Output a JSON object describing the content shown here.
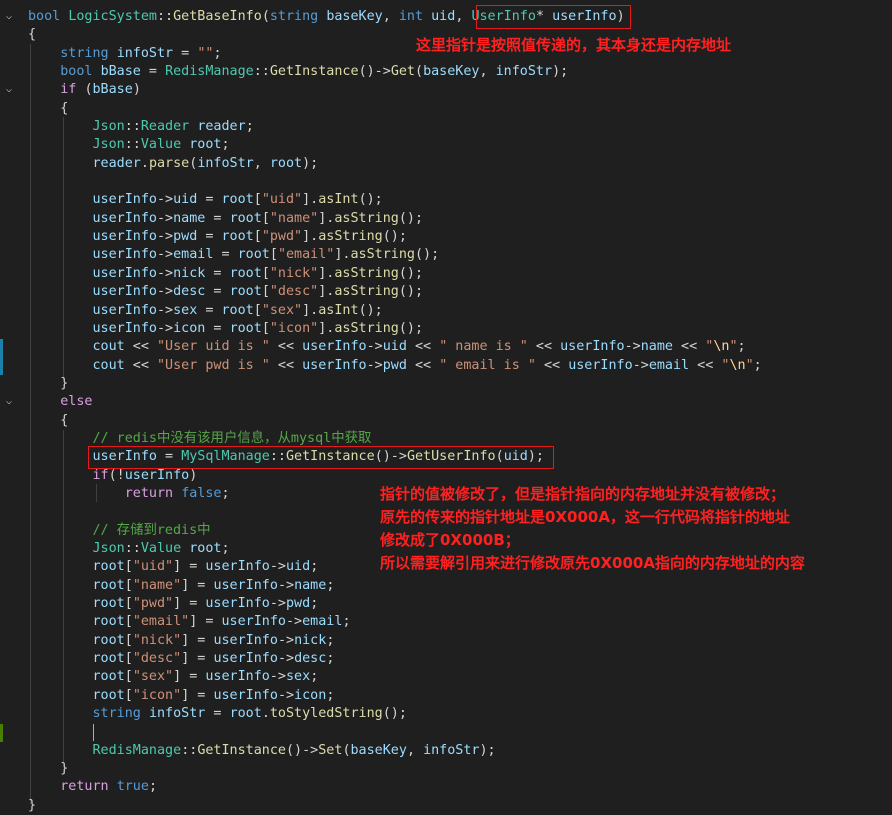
{
  "code": [
    [
      [
        "kw",
        "bool "
      ],
      [
        "ty",
        "LogicSystem"
      ],
      [
        "op",
        "::"
      ],
      [
        "fn",
        "GetBaseInfo"
      ],
      [
        "op",
        "("
      ],
      [
        "kw",
        "string "
      ],
      [
        "vr",
        "baseKey"
      ],
      [
        "op",
        ", "
      ],
      [
        "kw",
        "int "
      ],
      [
        "vr",
        "uid"
      ],
      [
        "op",
        ", "
      ],
      [
        "ty",
        "UserInfo"
      ],
      [
        "op",
        "* "
      ],
      [
        "vr",
        "userInfo"
      ],
      [
        "op",
        ")"
      ]
    ],
    [
      [
        "op",
        "{"
      ]
    ],
    [
      [
        "op",
        "    "
      ],
      [
        "kw",
        "string "
      ],
      [
        "vr",
        "infoStr"
      ],
      [
        "op",
        " = "
      ],
      [
        "st",
        "\"\""
      ],
      [
        "op",
        ";"
      ]
    ],
    [
      [
        "op",
        "    "
      ],
      [
        "kw",
        "bool "
      ],
      [
        "vr",
        "bBase"
      ],
      [
        "op",
        " = "
      ],
      [
        "ty",
        "RedisManage"
      ],
      [
        "op",
        "::"
      ],
      [
        "fn",
        "GetInstance"
      ],
      [
        "op",
        "()->"
      ],
      [
        "fn",
        "Get"
      ],
      [
        "op",
        "("
      ],
      [
        "vr",
        "baseKey"
      ],
      [
        "op",
        ", "
      ],
      [
        "vr",
        "infoStr"
      ],
      [
        "op",
        ");"
      ]
    ],
    [
      [
        "op",
        "    "
      ],
      [
        "fl",
        "if "
      ],
      [
        "op",
        "("
      ],
      [
        "vr",
        "bBase"
      ],
      [
        "op",
        ")"
      ]
    ],
    [
      [
        "op",
        "    {"
      ]
    ],
    [
      [
        "op",
        "        "
      ],
      [
        "ty",
        "Json"
      ],
      [
        "op",
        "::"
      ],
      [
        "ty",
        "Reader "
      ],
      [
        "vr",
        "reader"
      ],
      [
        "op",
        ";"
      ]
    ],
    [
      [
        "op",
        "        "
      ],
      [
        "ty",
        "Json"
      ],
      [
        "op",
        "::"
      ],
      [
        "ty",
        "Value "
      ],
      [
        "vr",
        "root"
      ],
      [
        "op",
        ";"
      ]
    ],
    [
      [
        "op",
        "        "
      ],
      [
        "vr",
        "reader"
      ],
      [
        "op",
        "."
      ],
      [
        "fn",
        "parse"
      ],
      [
        "op",
        "("
      ],
      [
        "vr",
        "infoStr"
      ],
      [
        "op",
        ", "
      ],
      [
        "vr",
        "root"
      ],
      [
        "op",
        ");"
      ]
    ],
    [],
    [
      [
        "op",
        "        "
      ],
      [
        "vr",
        "userInfo"
      ],
      [
        "op",
        "->"
      ],
      [
        "vr",
        "uid"
      ],
      [
        "op",
        " = "
      ],
      [
        "vr",
        "root"
      ],
      [
        "op",
        "["
      ],
      [
        "st",
        "\"uid\""
      ],
      [
        "op",
        "]."
      ],
      [
        "fn",
        "asInt"
      ],
      [
        "op",
        "();"
      ]
    ],
    [
      [
        "op",
        "        "
      ],
      [
        "vr",
        "userInfo"
      ],
      [
        "op",
        "->"
      ],
      [
        "vr",
        "name"
      ],
      [
        "op",
        " = "
      ],
      [
        "vr",
        "root"
      ],
      [
        "op",
        "["
      ],
      [
        "st",
        "\"name\""
      ],
      [
        "op",
        "]."
      ],
      [
        "fn",
        "asString"
      ],
      [
        "op",
        "();"
      ]
    ],
    [
      [
        "op",
        "        "
      ],
      [
        "vr",
        "userInfo"
      ],
      [
        "op",
        "->"
      ],
      [
        "vr",
        "pwd"
      ],
      [
        "op",
        " = "
      ],
      [
        "vr",
        "root"
      ],
      [
        "op",
        "["
      ],
      [
        "st",
        "\"pwd\""
      ],
      [
        "op",
        "]."
      ],
      [
        "fn",
        "asString"
      ],
      [
        "op",
        "();"
      ]
    ],
    [
      [
        "op",
        "        "
      ],
      [
        "vr",
        "userInfo"
      ],
      [
        "op",
        "->"
      ],
      [
        "vr",
        "email"
      ],
      [
        "op",
        " = "
      ],
      [
        "vr",
        "root"
      ],
      [
        "op",
        "["
      ],
      [
        "st",
        "\"email\""
      ],
      [
        "op",
        "]."
      ],
      [
        "fn",
        "asString"
      ],
      [
        "op",
        "();"
      ]
    ],
    [
      [
        "op",
        "        "
      ],
      [
        "vr",
        "userInfo"
      ],
      [
        "op",
        "->"
      ],
      [
        "vr",
        "nick"
      ],
      [
        "op",
        " = "
      ],
      [
        "vr",
        "root"
      ],
      [
        "op",
        "["
      ],
      [
        "st",
        "\"nick\""
      ],
      [
        "op",
        "]."
      ],
      [
        "fn",
        "asString"
      ],
      [
        "op",
        "();"
      ]
    ],
    [
      [
        "op",
        "        "
      ],
      [
        "vr",
        "userInfo"
      ],
      [
        "op",
        "->"
      ],
      [
        "vr",
        "desc"
      ],
      [
        "op",
        " = "
      ],
      [
        "vr",
        "root"
      ],
      [
        "op",
        "["
      ],
      [
        "st",
        "\"desc\""
      ],
      [
        "op",
        "]."
      ],
      [
        "fn",
        "asString"
      ],
      [
        "op",
        "();"
      ]
    ],
    [
      [
        "op",
        "        "
      ],
      [
        "vr",
        "userInfo"
      ],
      [
        "op",
        "->"
      ],
      [
        "vr",
        "sex"
      ],
      [
        "op",
        " = "
      ],
      [
        "vr",
        "root"
      ],
      [
        "op",
        "["
      ],
      [
        "st",
        "\"sex\""
      ],
      [
        "op",
        "]."
      ],
      [
        "fn",
        "asInt"
      ],
      [
        "op",
        "();"
      ]
    ],
    [
      [
        "op",
        "        "
      ],
      [
        "vr",
        "userInfo"
      ],
      [
        "op",
        "->"
      ],
      [
        "vr",
        "icon"
      ],
      [
        "op",
        " = "
      ],
      [
        "vr",
        "root"
      ],
      [
        "op",
        "["
      ],
      [
        "st",
        "\"icon\""
      ],
      [
        "op",
        "]."
      ],
      [
        "fn",
        "asString"
      ],
      [
        "op",
        "();"
      ]
    ],
    [
      [
        "op",
        "        "
      ],
      [
        "vr",
        "cout"
      ],
      [
        "op",
        " << "
      ],
      [
        "st",
        "\"User uid is \""
      ],
      [
        "op",
        " << "
      ],
      [
        "vr",
        "userInfo"
      ],
      [
        "op",
        "->"
      ],
      [
        "vr",
        "uid"
      ],
      [
        "op",
        " << "
      ],
      [
        "st",
        "\" name is \""
      ],
      [
        "op",
        " << "
      ],
      [
        "vr",
        "userInfo"
      ],
      [
        "op",
        "->"
      ],
      [
        "vr",
        "name"
      ],
      [
        "op",
        " << "
      ],
      [
        "st",
        "\""
      ],
      [
        "es",
        "\\n"
      ],
      [
        "st",
        "\""
      ],
      [
        "op",
        ";"
      ]
    ],
    [
      [
        "op",
        "        "
      ],
      [
        "vr",
        "cout"
      ],
      [
        "op",
        " << "
      ],
      [
        "st",
        "\"User pwd is \""
      ],
      [
        "op",
        " << "
      ],
      [
        "vr",
        "userInfo"
      ],
      [
        "op",
        "->"
      ],
      [
        "vr",
        "pwd"
      ],
      [
        "op",
        " << "
      ],
      [
        "st",
        "\" email is \""
      ],
      [
        "op",
        " << "
      ],
      [
        "vr",
        "userInfo"
      ],
      [
        "op",
        "->"
      ],
      [
        "vr",
        "email"
      ],
      [
        "op",
        " << "
      ],
      [
        "st",
        "\""
      ],
      [
        "es",
        "\\n"
      ],
      [
        "st",
        "\""
      ],
      [
        "op",
        ";"
      ]
    ],
    [
      [
        "op",
        "    }"
      ]
    ],
    [
      [
        "op",
        "    "
      ],
      [
        "fl",
        "else"
      ]
    ],
    [
      [
        "op",
        "    {"
      ]
    ],
    [
      [
        "op",
        "        "
      ],
      [
        "cm",
        "// redis中没有该用户信息，从mysql中获取"
      ]
    ],
    [
      [
        "op",
        "        "
      ],
      [
        "vr",
        "userInfo"
      ],
      [
        "op",
        " = "
      ],
      [
        "ty",
        "MySqlManage"
      ],
      [
        "op",
        "::"
      ],
      [
        "fn",
        "GetInstance"
      ],
      [
        "op",
        "()->"
      ],
      [
        "fn",
        "GetUserInfo"
      ],
      [
        "op",
        "("
      ],
      [
        "vr",
        "uid"
      ],
      [
        "op",
        ");"
      ]
    ],
    [
      [
        "op",
        "        "
      ],
      [
        "fl",
        "if"
      ],
      [
        "op",
        "(!"
      ],
      [
        "vr",
        "userInfo"
      ],
      [
        "op",
        ")"
      ]
    ],
    [
      [
        "op",
        "            "
      ],
      [
        "fl",
        "return "
      ],
      [
        "kw",
        "false"
      ],
      [
        "op",
        ";"
      ]
    ],
    [],
    [
      [
        "op",
        "        "
      ],
      [
        "cm",
        "// 存储到redis中"
      ]
    ],
    [
      [
        "op",
        "        "
      ],
      [
        "ty",
        "Json"
      ],
      [
        "op",
        "::"
      ],
      [
        "ty",
        "Value "
      ],
      [
        "vr",
        "root"
      ],
      [
        "op",
        ";"
      ]
    ],
    [
      [
        "op",
        "        "
      ],
      [
        "vr",
        "root"
      ],
      [
        "op",
        "["
      ],
      [
        "st",
        "\"uid\""
      ],
      [
        "op",
        "] = "
      ],
      [
        "vr",
        "userInfo"
      ],
      [
        "op",
        "->"
      ],
      [
        "vr",
        "uid"
      ],
      [
        "op",
        ";"
      ]
    ],
    [
      [
        "op",
        "        "
      ],
      [
        "vr",
        "root"
      ],
      [
        "op",
        "["
      ],
      [
        "st",
        "\"name\""
      ],
      [
        "op",
        "] = "
      ],
      [
        "vr",
        "userInfo"
      ],
      [
        "op",
        "->"
      ],
      [
        "vr",
        "name"
      ],
      [
        "op",
        ";"
      ]
    ],
    [
      [
        "op",
        "        "
      ],
      [
        "vr",
        "root"
      ],
      [
        "op",
        "["
      ],
      [
        "st",
        "\"pwd\""
      ],
      [
        "op",
        "] = "
      ],
      [
        "vr",
        "userInfo"
      ],
      [
        "op",
        "->"
      ],
      [
        "vr",
        "pwd"
      ],
      [
        "op",
        ";"
      ]
    ],
    [
      [
        "op",
        "        "
      ],
      [
        "vr",
        "root"
      ],
      [
        "op",
        "["
      ],
      [
        "st",
        "\"email\""
      ],
      [
        "op",
        "] = "
      ],
      [
        "vr",
        "userInfo"
      ],
      [
        "op",
        "->"
      ],
      [
        "vr",
        "email"
      ],
      [
        "op",
        ";"
      ]
    ],
    [
      [
        "op",
        "        "
      ],
      [
        "vr",
        "root"
      ],
      [
        "op",
        "["
      ],
      [
        "st",
        "\"nick\""
      ],
      [
        "op",
        "] = "
      ],
      [
        "vr",
        "userInfo"
      ],
      [
        "op",
        "->"
      ],
      [
        "vr",
        "nick"
      ],
      [
        "op",
        ";"
      ]
    ],
    [
      [
        "op",
        "        "
      ],
      [
        "vr",
        "root"
      ],
      [
        "op",
        "["
      ],
      [
        "st",
        "\"desc\""
      ],
      [
        "op",
        "] = "
      ],
      [
        "vr",
        "userInfo"
      ],
      [
        "op",
        "->"
      ],
      [
        "vr",
        "desc"
      ],
      [
        "op",
        ";"
      ]
    ],
    [
      [
        "op",
        "        "
      ],
      [
        "vr",
        "root"
      ],
      [
        "op",
        "["
      ],
      [
        "st",
        "\"sex\""
      ],
      [
        "op",
        "] = "
      ],
      [
        "vr",
        "userInfo"
      ],
      [
        "op",
        "->"
      ],
      [
        "vr",
        "sex"
      ],
      [
        "op",
        ";"
      ]
    ],
    [
      [
        "op",
        "        "
      ],
      [
        "vr",
        "root"
      ],
      [
        "op",
        "["
      ],
      [
        "st",
        "\"icon\""
      ],
      [
        "op",
        "] = "
      ],
      [
        "vr",
        "userInfo"
      ],
      [
        "op",
        "->"
      ],
      [
        "vr",
        "icon"
      ],
      [
        "op",
        ";"
      ]
    ],
    [
      [
        "op",
        "        "
      ],
      [
        "kw",
        "string "
      ],
      [
        "vr",
        "infoStr"
      ],
      [
        "op",
        " = "
      ],
      [
        "vr",
        "root"
      ],
      [
        "op",
        "."
      ],
      [
        "fn",
        "toStyledString"
      ],
      [
        "op",
        "();"
      ]
    ],
    [],
    [
      [
        "op",
        "        "
      ],
      [
        "ty",
        "RedisManage"
      ],
      [
        "op",
        "::"
      ],
      [
        "fn",
        "GetInstance"
      ],
      [
        "op",
        "()->"
      ],
      [
        "fn",
        "Set"
      ],
      [
        "op",
        "("
      ],
      [
        "vr",
        "baseKey"
      ],
      [
        "op",
        ", "
      ],
      [
        "vr",
        "infoStr"
      ],
      [
        "op",
        ");"
      ]
    ],
    [
      [
        "op",
        "    }"
      ]
    ],
    [
      [
        "op",
        "    "
      ],
      [
        "fl",
        "return "
      ],
      [
        "kw",
        "true"
      ],
      [
        "op",
        ";"
      ]
    ],
    [
      [
        "op",
        "}"
      ]
    ]
  ],
  "fold_lines": [
    0,
    4,
    21
  ],
  "annotations": {
    "note_top": "这里指针是按照值传递的，其本身还是内存地址",
    "note_bottom_1": "指针的值被修改了，但是指针指向的内存地址并没有被修改；",
    "note_bottom_2": "原先的传来的指针地址是0X000A，这一行代码将指针的地址",
    "note_bottom_3": "修改成了0X000B；",
    "note_bottom_4": "所以需要解引用来进行修改原先0X000A指向的内存地址的内容"
  },
  "colors": {
    "annotation": "#ff2020",
    "box": "#e51b1b",
    "background": "#1f1f1f"
  }
}
